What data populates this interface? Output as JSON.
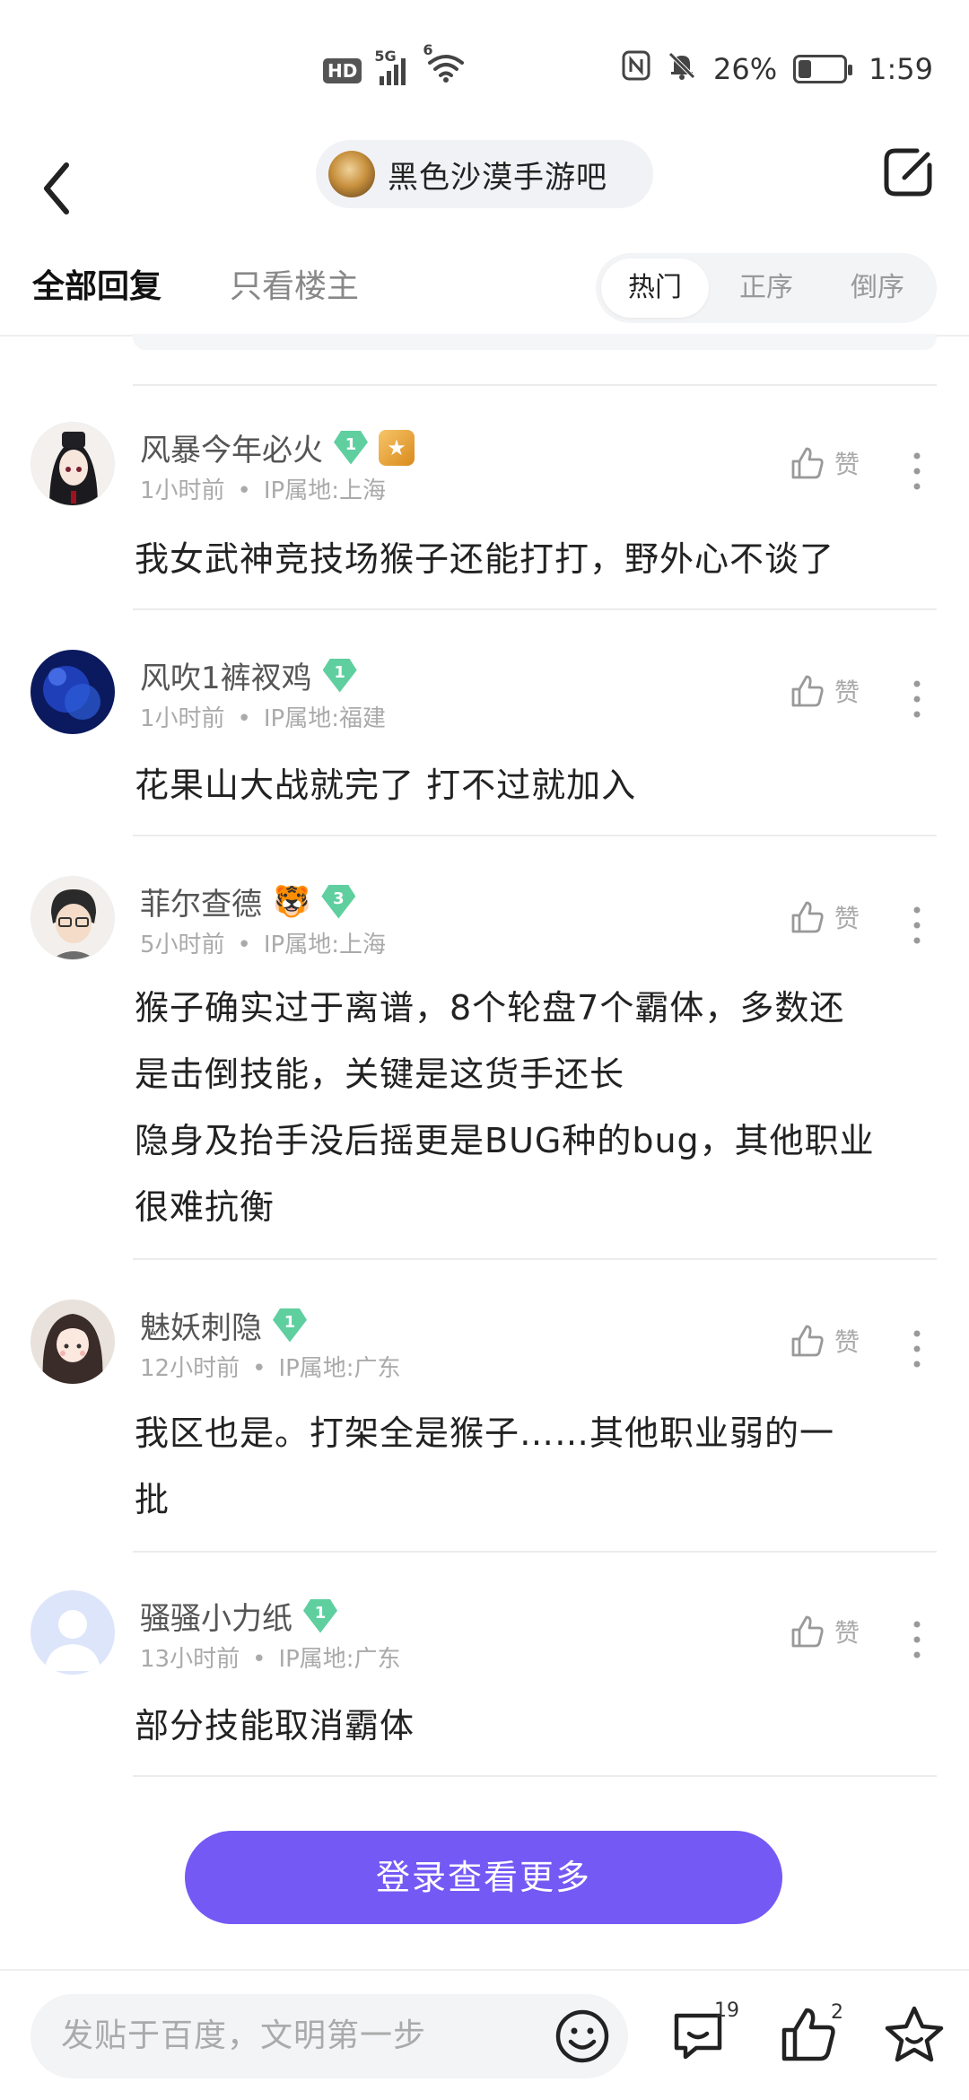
{
  "status_bar": {
    "hd": "HD",
    "network": "5G",
    "wifi_badge": "6",
    "battery": "26%",
    "battery_level": 0.26,
    "time": "1:59"
  },
  "nav": {
    "forum_name": "黑色沙漠手游吧"
  },
  "tabs": {
    "all_replies": "全部回复",
    "op_only": "只看楼主",
    "sort_hot": "热门",
    "sort_asc": "正序",
    "sort_desc": "倒序"
  },
  "like_label": "赞",
  "comments": [
    {
      "name": "风暴今年必火",
      "level": "1",
      "time": "1小时前",
      "ip": "IP属地:上海",
      "text": "我女武神竞技场猴子还能打打，野外心不谈了"
    },
    {
      "name": "风吹1裤衩鸡",
      "level": "1",
      "time": "1小时前",
      "ip": "IP属地:福建",
      "text": "花果山大战就完了 打不过就加入"
    },
    {
      "name": "菲尔查德",
      "level": "3",
      "time": "5小时前",
      "ip": "IP属地:上海",
      "text_lines": [
        "猴子确实过于离谱，8个轮盘7个霸体，多数还",
        "是击倒技能，关键是这货手还长",
        "隐身及抬手没后摇更是BUG种的bug，其他职业",
        "很难抗衡"
      ]
    },
    {
      "name": "魅妖刺隐",
      "level": "1",
      "time": "12小时前",
      "ip": "IP属地:广东",
      "text_lines": [
        "我区也是。打架全是猴子……其他职业弱的一",
        "批"
      ]
    },
    {
      "name": "骚骚小力纸",
      "level": "1",
      "time": "13小时前",
      "ip": "IP属地:广东",
      "text": "部分技能取消霸体"
    }
  ],
  "login_more": "登录查看更多",
  "bottom_bar": {
    "input_placeholder": "发贴于百度，文明第一步",
    "comment_count": "19",
    "like_count": "2"
  },
  "colors": {
    "accent": "#7559f5",
    "level_badge": "#5fcf9f"
  }
}
